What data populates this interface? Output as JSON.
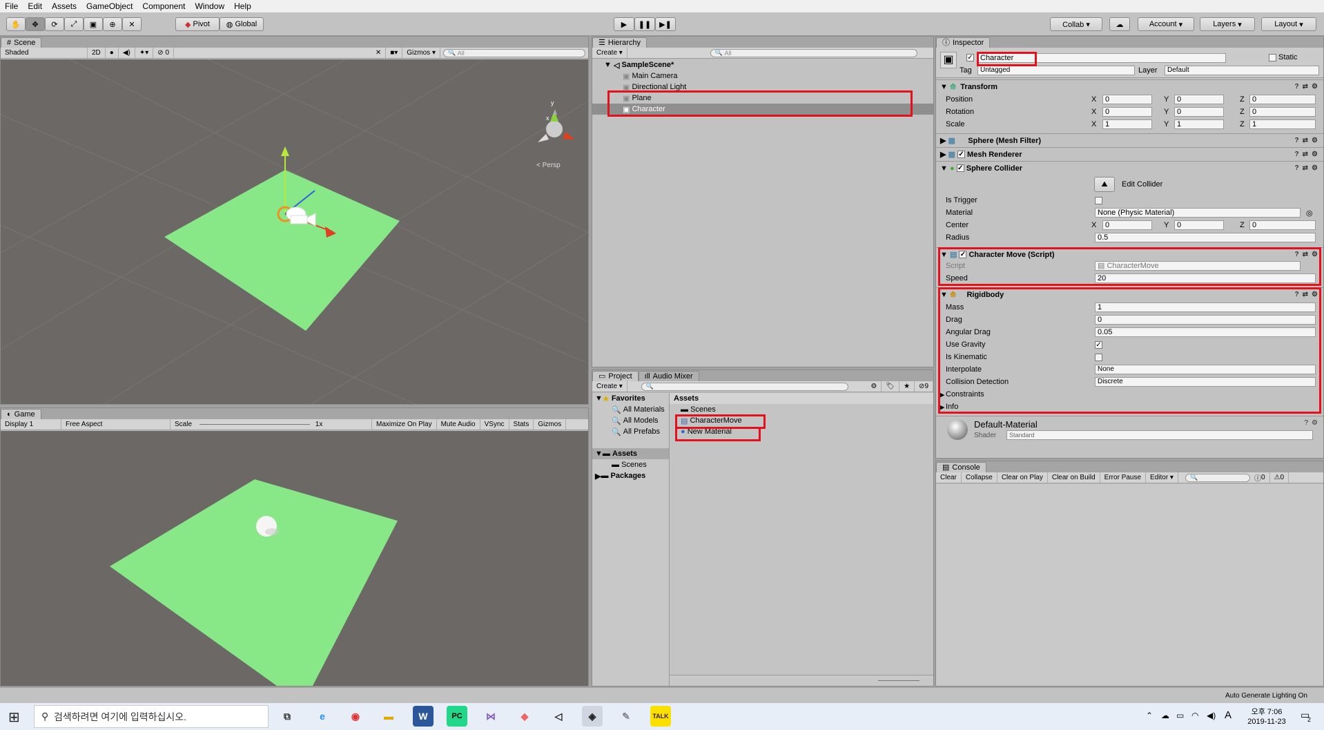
{
  "menu": [
    "File",
    "Edit",
    "Assets",
    "GameObject",
    "Component",
    "Window",
    "Help"
  ],
  "toolbar": {
    "pivot": "Pivot",
    "global": "Global",
    "collab": "Collab ▾",
    "account": "Account",
    "layers": "Layers",
    "layout": "Layout"
  },
  "scene": {
    "tab": "Scene",
    "shaded": "Shaded",
    "mode2d": "2D",
    "gizmos": "Gizmos",
    "search": "All",
    "persp": "< Persp",
    "layers_count": "0"
  },
  "game": {
    "tab": "Game",
    "display": "Display 1",
    "aspect": "Free Aspect",
    "scale_label": "Scale",
    "scale_value": "1x",
    "buttons": [
      "Maximize On Play",
      "Mute Audio",
      "VSync",
      "Stats",
      "Gizmos"
    ]
  },
  "hierarchy": {
    "tab": "Hierarchy",
    "create": "Create ▾",
    "search": "All",
    "scene_name": "SampleScene*",
    "items": [
      "Main Camera",
      "Directional Light",
      "Plane",
      "Character"
    ]
  },
  "project": {
    "tab": "Project",
    "tab2": "Audio Mixer",
    "create": "Create ▾",
    "hidden_count": "9",
    "favorites": "Favorites",
    "fav_items": [
      "All Materials",
      "All Models",
      "All Prefabs"
    ],
    "tree_assets": "Assets",
    "tree_scenes": "Scenes",
    "tree_packages": "Packages",
    "breadcrumb": "Assets",
    "files": [
      "Scenes",
      "CharacterMove",
      "New Material"
    ]
  },
  "inspector": {
    "tab": "Inspector",
    "object_name": "Character",
    "static": "Static",
    "tag_label": "Tag",
    "tag_value": "Untagged",
    "layer_label": "Layer",
    "layer_value": "Default",
    "transform": {
      "title": "Transform",
      "rows": [
        {
          "label": "Position",
          "x": "0",
          "y": "0",
          "z": "0"
        },
        {
          "label": "Rotation",
          "x": "0",
          "y": "0",
          "z": "0"
        },
        {
          "label": "Scale",
          "x": "1",
          "y": "1",
          "z": "1"
        }
      ]
    },
    "mesh_filter": "Sphere (Mesh Filter)",
    "mesh_renderer": "Mesh Renderer",
    "collider": {
      "title": "Sphere Collider",
      "edit": "Edit Collider",
      "is_trigger": "Is Trigger",
      "material_label": "Material",
      "material_value": "None (Physic Material)",
      "center_label": "Center",
      "cx": "0",
      "cy": "0",
      "cz": "0",
      "radius_label": "Radius",
      "radius": "0.5"
    },
    "script": {
      "title": "Character Move (Script)",
      "script_label": "Script",
      "script_value": "CharacterMove",
      "speed_label": "Speed",
      "speed": "20"
    },
    "rigidbody": {
      "title": "Rigidbody",
      "mass_label": "Mass",
      "mass": "1",
      "drag_label": "Drag",
      "drag": "0",
      "angular_label": "Angular Drag",
      "angular": "0.05",
      "gravity_label": "Use Gravity",
      "kinematic_label": "Is Kinematic",
      "interp_label": "Interpolate",
      "interp": "None",
      "collision_label": "Collision Detection",
      "collision": "Discrete",
      "constraints": "Constraints",
      "info": "Info"
    },
    "material": {
      "name": "Default-Material",
      "shader_label": "Shader",
      "shader": "Standard"
    }
  },
  "console": {
    "tab": "Console",
    "buttons": [
      "Clear",
      "Collapse",
      "Clear on Play",
      "Clear on Build",
      "Error Pause",
      "Editor ▾"
    ],
    "count1": "0",
    "count2": "0"
  },
  "status": "Auto Generate Lighting On",
  "taskbar": {
    "search": "검색하려면 여기에 입력하십시오.",
    "time": "오후 7:06",
    "date": "2019-11-23",
    "lang": "A",
    "notif": "2"
  }
}
